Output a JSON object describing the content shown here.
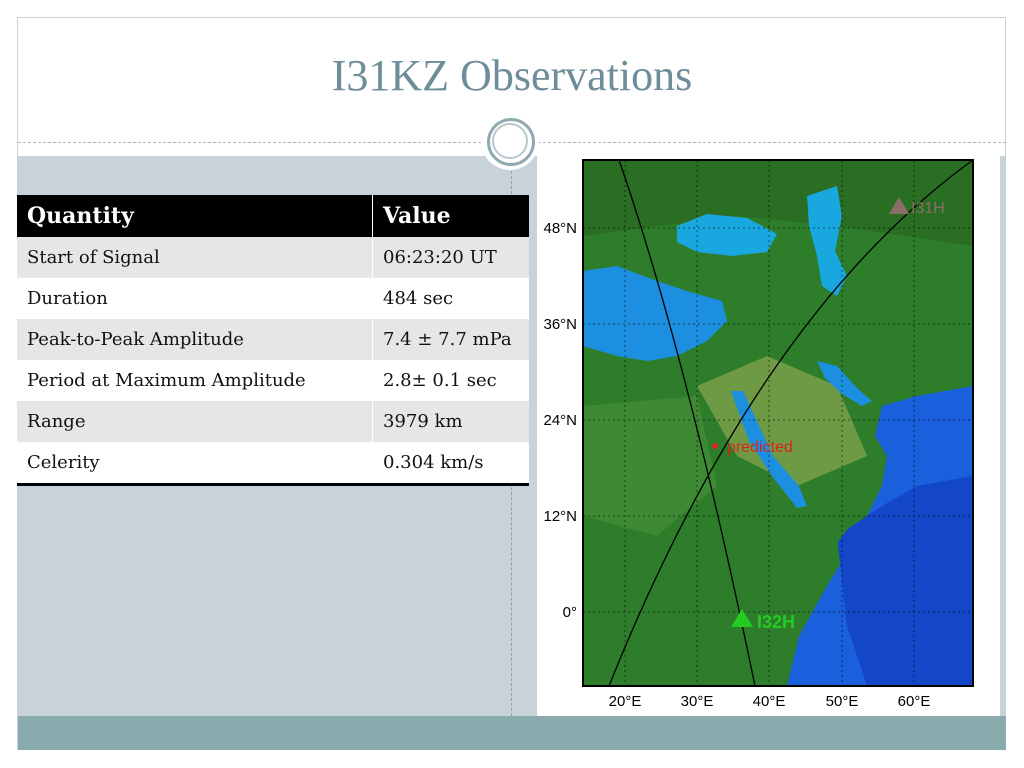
{
  "slide": {
    "title": "I31KZ Observations"
  },
  "table": {
    "headers": [
      "Quantity",
      "Value"
    ],
    "rows": [
      [
        "Start of Signal",
        "06:23:20 UT"
      ],
      [
        "Duration",
        "484 sec"
      ],
      [
        "Peak-to-Peak Amplitude",
        "7.4 ± 7.7 mPa"
      ],
      [
        "Period at Maximum Amplitude",
        "2.8± 0.1 sec"
      ],
      [
        "Range",
        "3979 km"
      ],
      [
        "Celerity",
        "0.304 km/s"
      ]
    ]
  },
  "map": {
    "lat_labels": [
      "48°N",
      "36°N",
      "24°N",
      "12°N",
      "0°"
    ],
    "lon_labels": [
      "20°E",
      "30°E",
      "40°E",
      "50°E",
      "60°E"
    ],
    "stations": [
      {
        "name": "I31H",
        "color": "#8a6f68"
      },
      {
        "name": "I32H",
        "color": "#22cc22"
      }
    ],
    "predicted_label": "predicted",
    "predicted_color": "#d9261c"
  }
}
